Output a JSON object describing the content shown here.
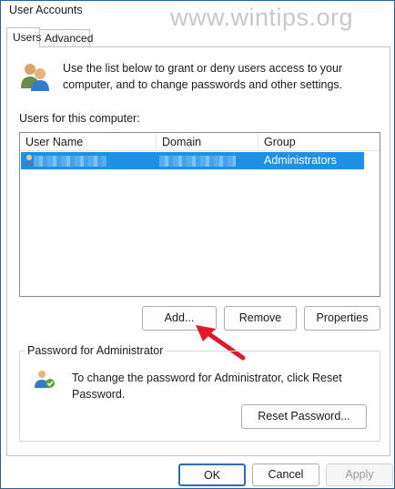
{
  "window": {
    "title": "User Accounts",
    "watermark": "www.wintips.org"
  },
  "tabs": [
    {
      "label": "Users",
      "selected": true
    },
    {
      "label": "Advanced",
      "selected": false
    }
  ],
  "intro": {
    "text": "Use the list below to grant or deny users access to your computer, and to change passwords and other settings."
  },
  "users_list": {
    "label": "Users for this computer:",
    "columns": [
      "User Name",
      "Domain",
      "Group"
    ],
    "rows": [
      {
        "group": "Administrators",
        "selected": true
      }
    ]
  },
  "list_buttons": {
    "add": "Add...",
    "remove": "Remove",
    "properties": "Properties"
  },
  "password_group": {
    "title": "Password for Administrator",
    "text": "To change the password for Administrator, click Reset Password.",
    "reset_button": "Reset Password..."
  },
  "dialog_buttons": {
    "ok": "OK",
    "cancel": "Cancel",
    "apply": "Apply"
  },
  "colors": {
    "accent": "#1e90e6",
    "arrow": "#e0182a",
    "border": "#2f5f9a"
  }
}
